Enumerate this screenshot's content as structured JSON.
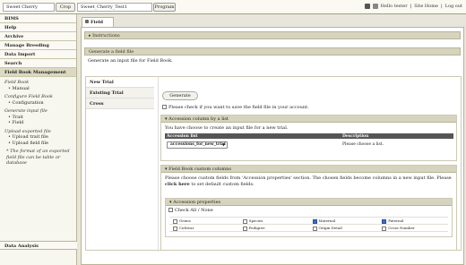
{
  "topbar": {
    "crop_value": "Sweet Cherry",
    "crop_button": "Crop",
    "program_value": "Sweet_Cherry_Test1",
    "program_button": "Program",
    "hello_user": "Hello tester",
    "site_home": "Site Home",
    "logout": "Log out",
    "sep1": "|",
    "sep2": "|"
  },
  "sidebar": {
    "items": [
      {
        "label": "BIMS"
      },
      {
        "label": "Help"
      },
      {
        "label": "Archive"
      },
      {
        "label": "Manage Breeding"
      },
      {
        "label": "Data Import"
      },
      {
        "label": "Search"
      },
      {
        "label": "Field Book Management"
      }
    ],
    "field_book_heading": "Field Book",
    "manual_link": "Manual",
    "configure_heading": "Configure Field Book",
    "configuration_link": "Configuration",
    "generate_heading": "Generate input file",
    "trait_link": "Trait",
    "field_link": "Field",
    "upload_heading": "Upload exported file",
    "upload_trait_link": "Upload trait file",
    "upload_field_link": "Upload field file",
    "note": "* The format of an exported field file can be table or database",
    "bottom_item": "Data Analysis"
  },
  "main": {
    "tab_label": "Field",
    "instructions": "Instructions",
    "generate_section": "Generate a field file",
    "generate_desc": "Generate an input file for Field Book.",
    "vtabs": [
      "New Trial",
      "Existing Trial",
      "Cross"
    ],
    "generate_button": "Generate",
    "save_check_label": "Please check if you want to save the field file in your account.",
    "accession_list": {
      "heading": "Accession column by a list",
      "desc": "You have choose to create an input file for a new trial.",
      "col1": "Accession list",
      "col2": "Description",
      "selected": "accessions_for_new_trial",
      "description": "Please choose a list."
    },
    "custom_columns": {
      "heading": "Field Book custom columns",
      "desc_pre": "Please choose custom fields from 'Accession properties' section. The chosen fields become columns in a new input file. Please ",
      "click_here": "click here",
      "desc_post": " to set default custom fields."
    },
    "accession_props": {
      "heading": "Accession properties",
      "check_all": "Check All / None",
      "rows": [
        [
          {
            "label": "Genus",
            "checked": false
          },
          {
            "label": "Species",
            "checked": false
          },
          {
            "label": "Maternal",
            "checked": true
          },
          {
            "label": "Paternal",
            "checked": true
          }
        ],
        [
          {
            "label": "Cultivar",
            "checked": false
          },
          {
            "label": "Pedigree",
            "checked": false
          },
          {
            "label": "Origin Detail",
            "checked": false
          },
          {
            "label": "Cross Number",
            "checked": false
          }
        ]
      ]
    }
  }
}
